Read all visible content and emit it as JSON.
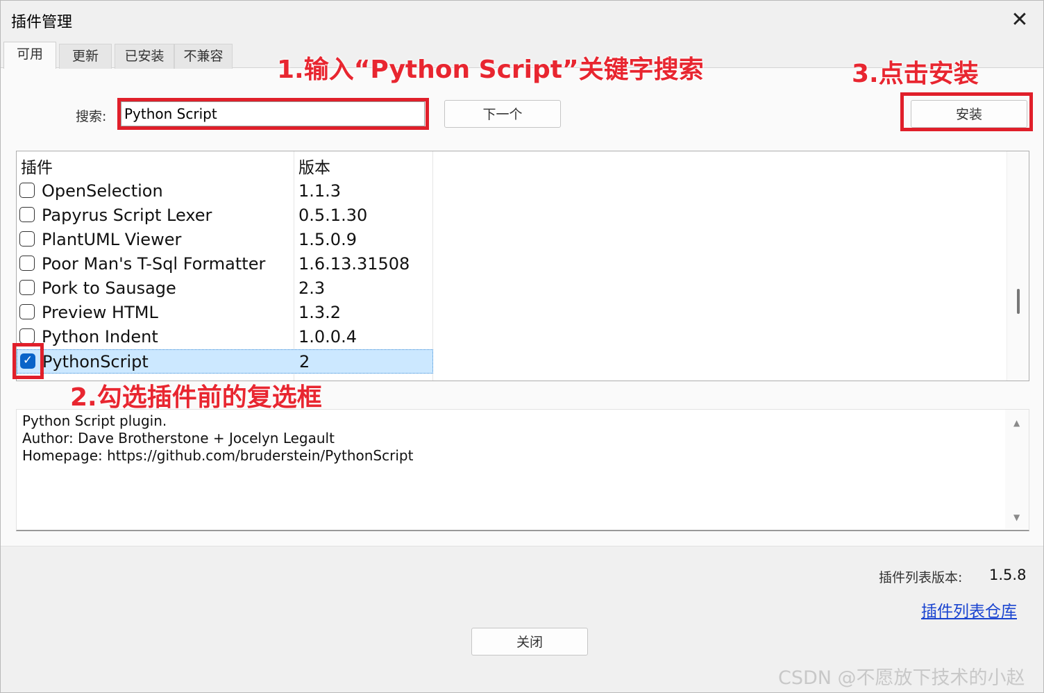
{
  "window": {
    "title": "插件管理",
    "close_glyph": "✕"
  },
  "tabs": [
    "可用",
    "更新",
    "已安装",
    "不兼容"
  ],
  "search": {
    "label": "搜索:",
    "value": "Python Script"
  },
  "buttons": {
    "next": "下一个",
    "install": "安装",
    "close": "关闭"
  },
  "annotations": {
    "step1": "1.输入“Python Script”关键字搜索",
    "step2": "2.勾选插件前的复选框",
    "step3": "3.点击安装",
    "color": "#e01f2a"
  },
  "list": {
    "headers": {
      "plugin": "插件",
      "version": "版本"
    },
    "rows": [
      {
        "name": "OpenSelection",
        "version": "1.1.3",
        "checked": false
      },
      {
        "name": "Papyrus Script Lexer",
        "version": "0.5.1.30",
        "checked": false
      },
      {
        "name": "PlantUML Viewer",
        "version": "1.5.0.9",
        "checked": false
      },
      {
        "name": "Poor Man's T-Sql Formatter",
        "version": "1.6.13.31508",
        "checked": false
      },
      {
        "name": "Pork to Sausage",
        "version": "2.3",
        "checked": false
      },
      {
        "name": "Preview HTML",
        "version": "1.3.2",
        "checked": false
      },
      {
        "name": "Python Indent",
        "version": "1.0.0.4",
        "checked": false
      },
      {
        "name": "PythonScript",
        "version": "2",
        "checked": true
      }
    ],
    "selected_color": "#cce8ff",
    "check_color": "#0a64c8"
  },
  "description": {
    "lines": [
      "Python Script plugin.",
      "Author: Dave Brotherstone + Jocelyn Legault",
      "Homepage: https://github.com/bruderstein/PythonScript"
    ]
  },
  "footer": {
    "list_version_label": "插件列表版本:",
    "list_version_value": "1.5.8",
    "repo_link": "插件列表仓库"
  },
  "watermark": "CSDN @不愿放下技术的小赵"
}
